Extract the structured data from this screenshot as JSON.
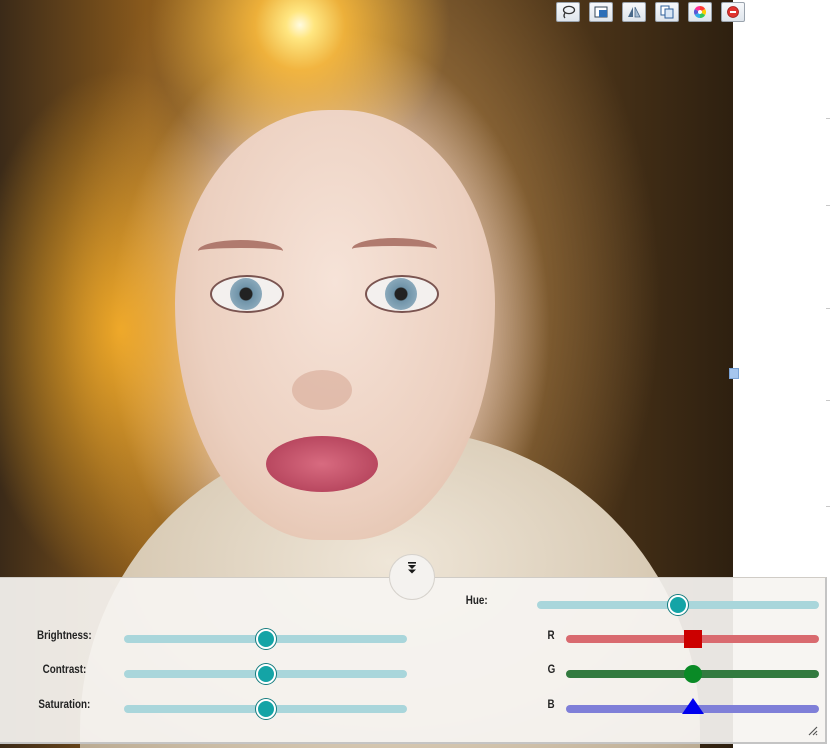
{
  "photo": {
    "subject": "portrait-woman-backlit"
  },
  "toolbar": {
    "buttons": [
      {
        "name": "lasso-icon"
      },
      {
        "name": "crop-icon"
      },
      {
        "name": "flip-icon"
      },
      {
        "name": "copy-icon"
      },
      {
        "name": "color-wheel-icon"
      },
      {
        "name": "close-icon"
      }
    ]
  },
  "panel": {
    "collapse_icon": "double-chevron-down-icon",
    "left_sliders": [
      {
        "label": "Brightness:",
        "value": 0.5
      },
      {
        "label": "Contrast:",
        "value": 0.5
      },
      {
        "label": "Saturation:",
        "value": 0.5
      }
    ],
    "hue": {
      "label": "Hue:",
      "value": 0.5
    },
    "rgb": [
      {
        "label": "R",
        "value": 0.5,
        "color": "#d96a6f",
        "knob_color": "#cc0000"
      },
      {
        "label": "G",
        "value": 0.5,
        "color": "#327a3f",
        "knob_color": "#0a8a26"
      },
      {
        "label": "B",
        "value": 0.5,
        "color": "#7f7fd8",
        "knob_color": "#0000ee"
      }
    ]
  },
  "colors": {
    "slider_teal": "#a9d6db",
    "knob_teal": "#14a4a6"
  }
}
